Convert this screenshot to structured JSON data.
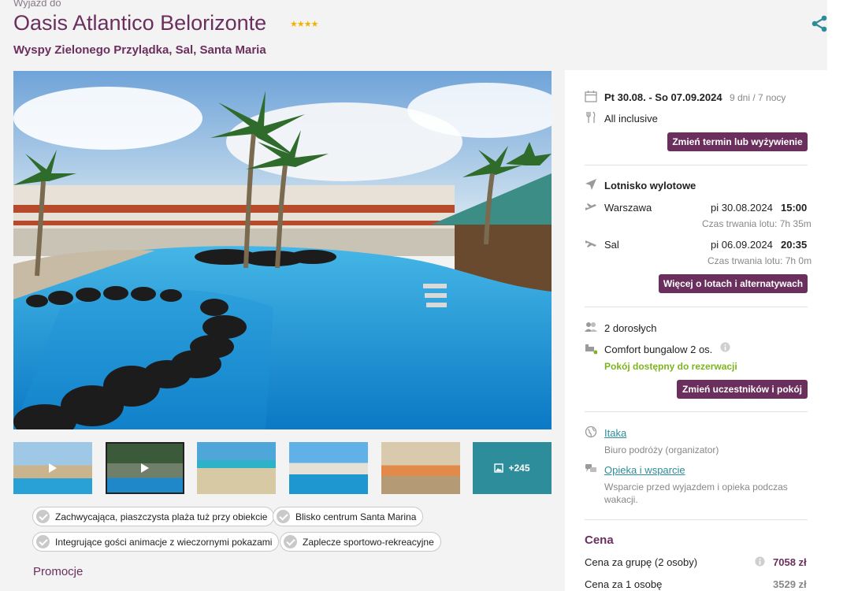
{
  "header": {
    "pre_title": "Wyjazd do",
    "title": "Oasis Atlantico Belorizonte",
    "stars": "★★★★",
    "location": "Wyspy Zielonego Przylądka, Sal, Santa Maria"
  },
  "gallery": {
    "more_count": "+245"
  },
  "tags": [
    "Zachwycająca, piaszczysta plaża tuż przy obiekcie",
    "Blisko centrum Santa Marina",
    "Integrujące gości animacje z wieczornymi pokazami",
    "Zaplecze sportowo-rekreacyjne"
  ],
  "promotions_heading": "Promocje",
  "sidebar": {
    "dates": "Pt 30.08. - So 07.09.2024",
    "duration": "9 dni / 7 nocy",
    "board": "All inclusive",
    "change_term_button": "Zmień termin lub wyżywienie",
    "airport_heading": "Lotnisko wylotowe",
    "outbound": {
      "city": "Warszawa",
      "date": "pi 30.08.2024",
      "time": "15:00",
      "flight_time": "Czas trwania lotu: 7h 35m"
    },
    "return": {
      "city": "Sal",
      "date": "pi 06.09.2024",
      "time": "20:35",
      "flight_time": "Czas trwania lotu: 7h 0m"
    },
    "flights_button": "Więcej o lotach i alternatywach",
    "guests": "2 dorosłych",
    "room": "Comfort bungalow 2 os.",
    "room_status": "Pokój dostępny do rezerwacji",
    "change_guests_button": "Zmień uczestników i pokój",
    "organizer_name": "Itaka",
    "organizer_desc": "Biuro podróży (organizator)",
    "support_link": "Opieka i wsparcie",
    "support_desc_1": "Wsparcie przed wyjazdem i opieka podczas",
    "support_desc_2": "wakacji.",
    "price_heading": "Cena",
    "price_group_label": "Cena za grupę (2 osoby)",
    "price_group_value": "7058 zł",
    "price_person_label": "Cena za 1 osobę",
    "price_person_value": "3529 zł"
  },
  "colors": {
    "brand": "#6b2f5e",
    "accent": "#2e8d9a",
    "available": "#7ab51d",
    "stars": "#f0b300"
  },
  "icons": [
    "share-icon",
    "calendar-icon",
    "cutlery-icon",
    "plane-icon",
    "plane-takeoff-icon",
    "plane-landing-icon",
    "people-icon",
    "bed-icon",
    "info-icon",
    "globe-icon",
    "support-icon",
    "check-icon",
    "image-icon",
    "play-icon"
  ]
}
